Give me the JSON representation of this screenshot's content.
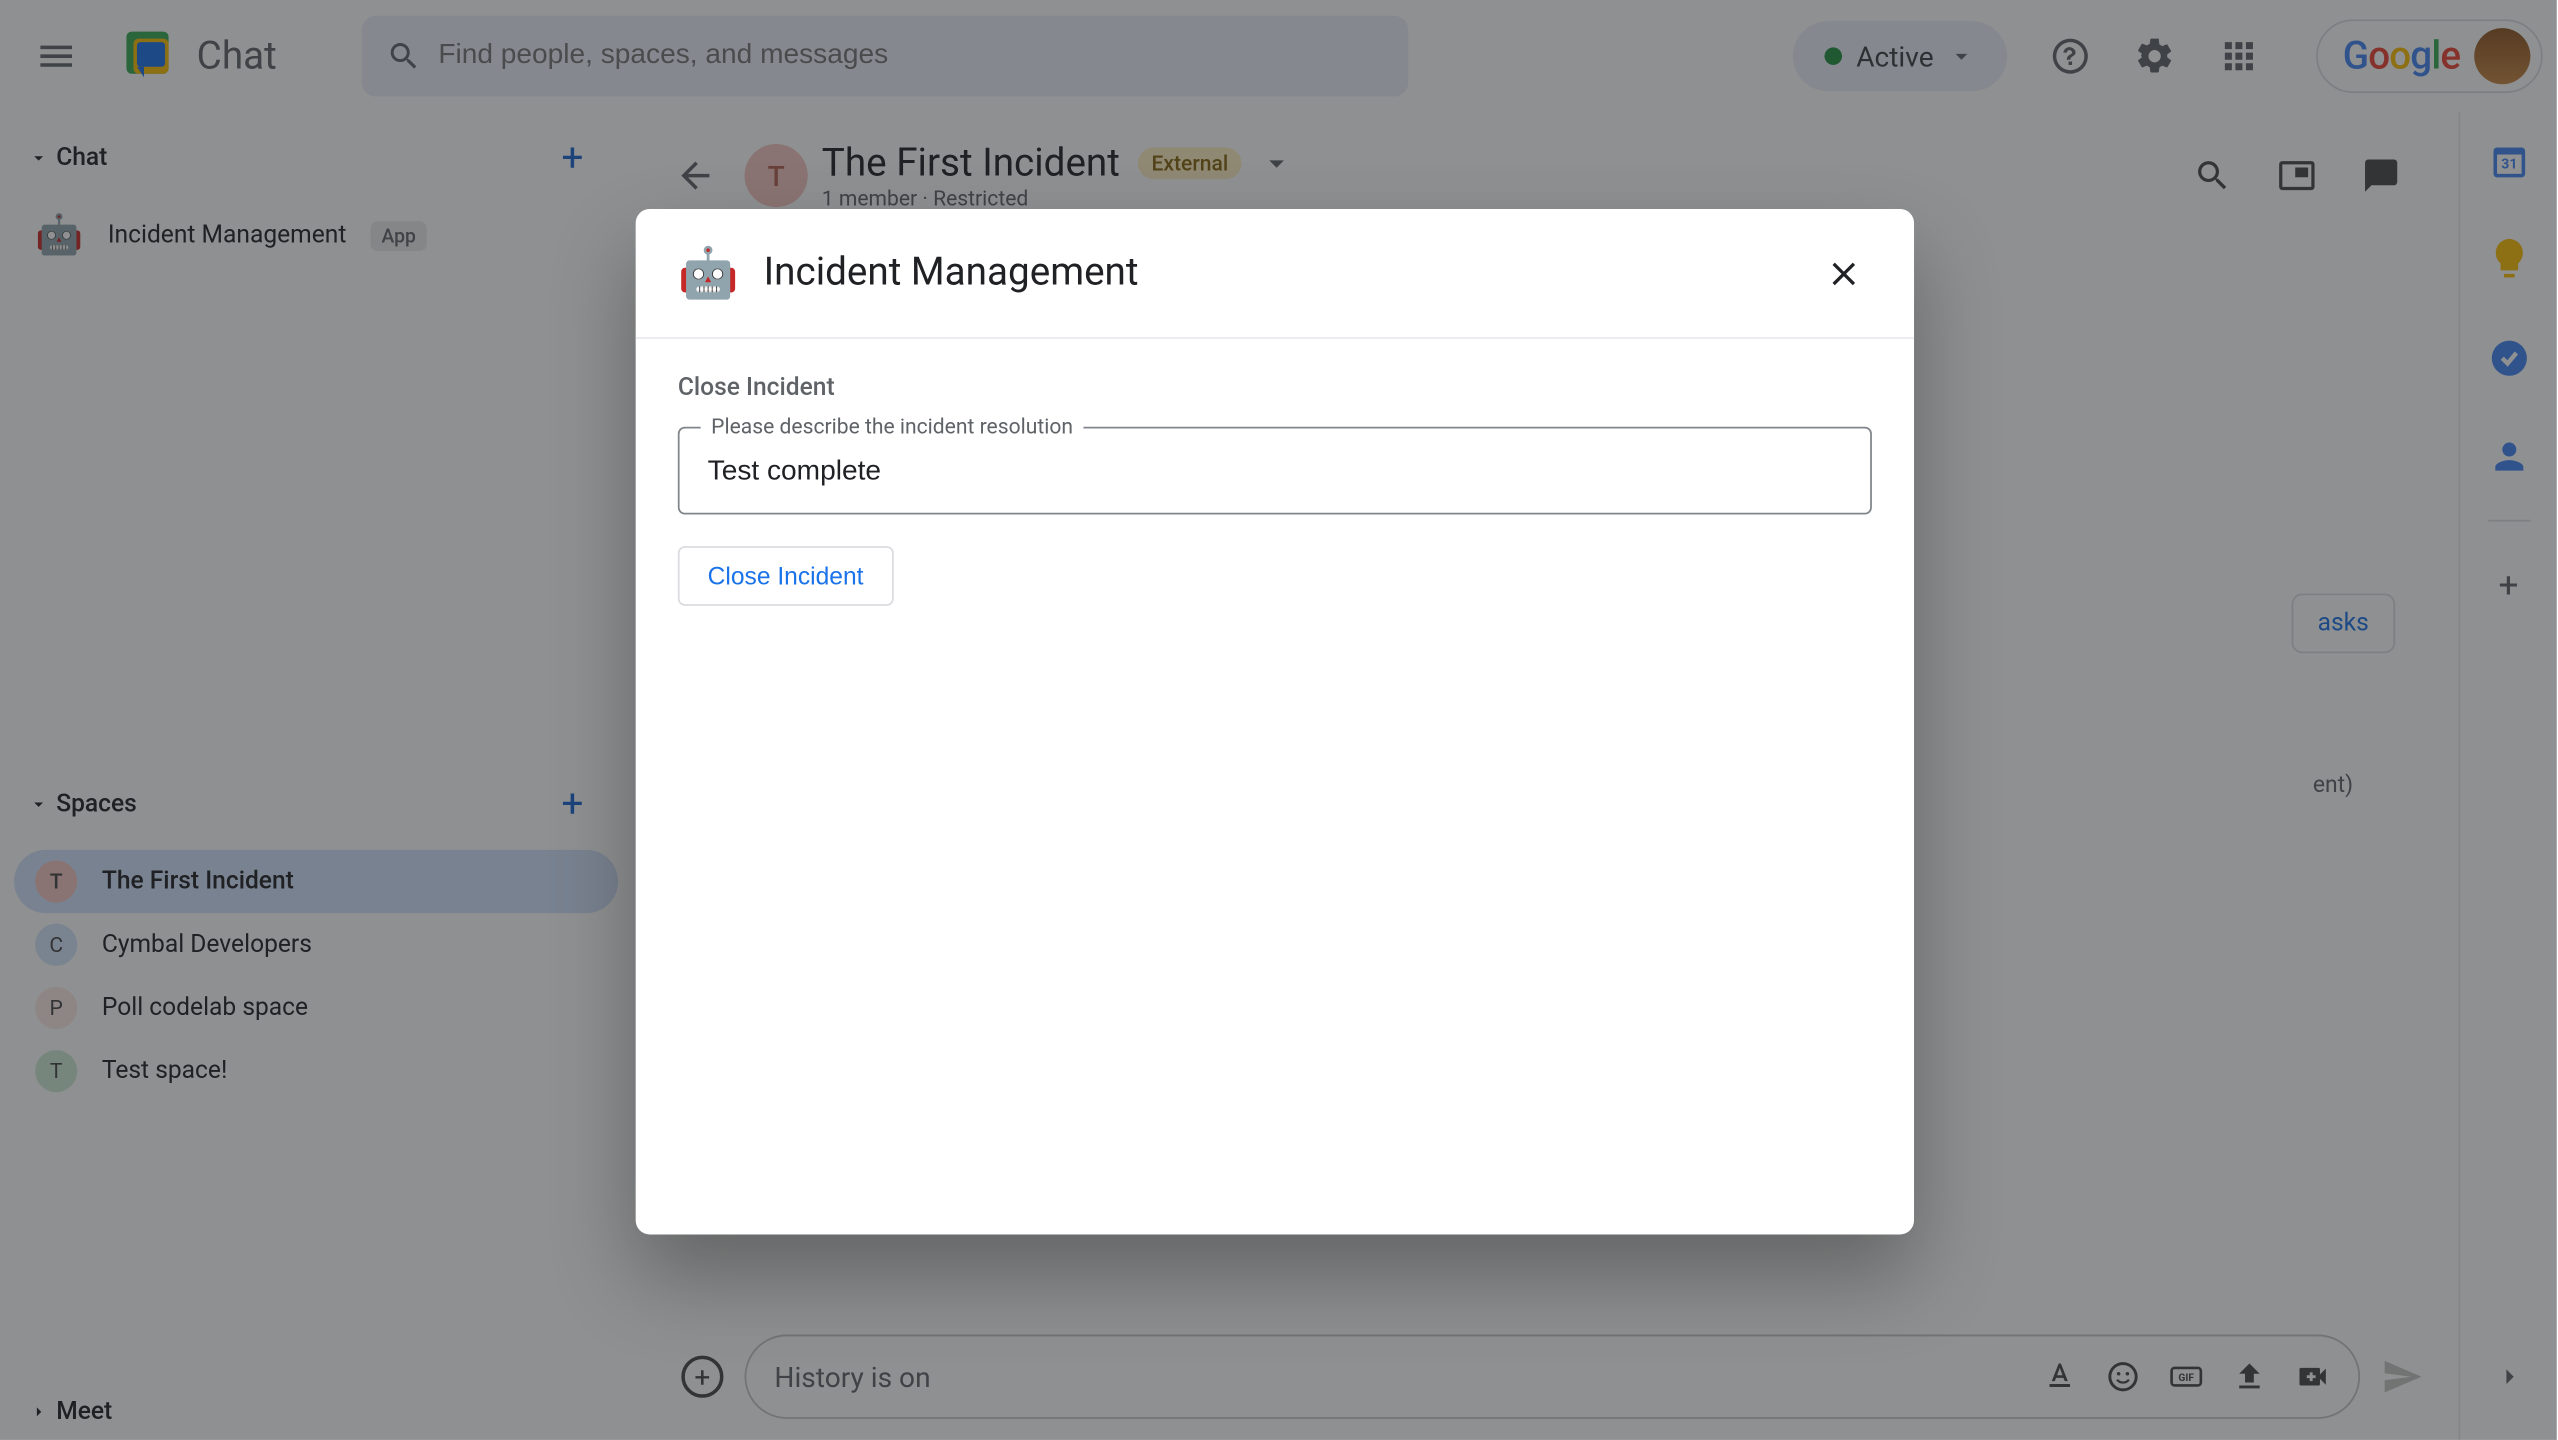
{
  "header": {
    "app_name": "Chat",
    "search_placeholder": "Find people, spaces, and messages",
    "status_label": "Active"
  },
  "sidebar": {
    "chat_section": "Chat",
    "chat_item": {
      "label": "Incident Management",
      "badge": "App"
    },
    "spaces_section": "Spaces",
    "spaces": [
      {
        "initial": "T",
        "label": "The First Incident",
        "active": true,
        "color": "#f4c7c3"
      },
      {
        "initial": "C",
        "label": "Cymbal Developers",
        "active": false,
        "color": "#d4e4fc"
      },
      {
        "initial": "P",
        "label": "Poll codelab space",
        "active": false,
        "color": "#fce8e6"
      },
      {
        "initial": "T",
        "label": "Test space!",
        "active": false,
        "color": "#ceead6"
      }
    ],
    "meet_section": "Meet"
  },
  "space_header": {
    "initial": "T",
    "title": "The First Incident",
    "external_badge": "External",
    "subtitle": "1 member  ·  Restricted"
  },
  "compose": {
    "placeholder": "History is on"
  },
  "dialog": {
    "title": "Incident Management",
    "section_title": "Close Incident",
    "field_label": "Please describe the incident resolution",
    "field_value": "Test complete",
    "submit_label": "Close Incident"
  },
  "main_hidden": {
    "tasks_btn": "asks",
    "detail_suffix": "ent)"
  }
}
